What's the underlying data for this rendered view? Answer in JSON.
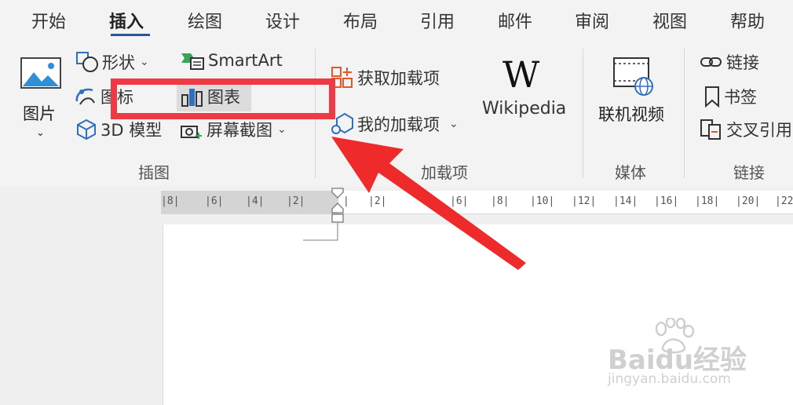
{
  "ribbon_tabs": [
    "开始",
    "插入",
    "绘图",
    "设计",
    "布局",
    "引用",
    "邮件",
    "审阅",
    "视图",
    "帮助"
  ],
  "active_tab_index": 1,
  "groups": {
    "illustrations": {
      "label": "插图",
      "picture": "图片",
      "shapes": "形状",
      "icons": "图标",
      "model_3d": "3D 模型",
      "smartart": "SmartArt",
      "chart": "图表",
      "screenshot": "屏幕截图"
    },
    "addins": {
      "label": "加载项",
      "get_addins": "获取加载项",
      "my_addins": "我的加载项",
      "wikipedia": "Wikipedia"
    },
    "media": {
      "label": "媒体",
      "online_video": "联机视频"
    },
    "links": {
      "label": "链接",
      "link": "链接",
      "bookmark": "书签",
      "cross_ref": "交叉引用"
    }
  },
  "ruler": {
    "left_ticks": [
      "8",
      "6",
      "4",
      "2"
    ],
    "right_ticks": [
      "2",
      "6",
      "8",
      "10",
      "12",
      "14",
      "16",
      "18",
      "20",
      "22"
    ]
  },
  "watermark": {
    "brand": "Baidu经验",
    "url": "jingyan.baidu.com"
  },
  "colors": {
    "highlight": "#ee3a44",
    "arrow": "#ee2a2a",
    "accent": "#2b579a"
  }
}
